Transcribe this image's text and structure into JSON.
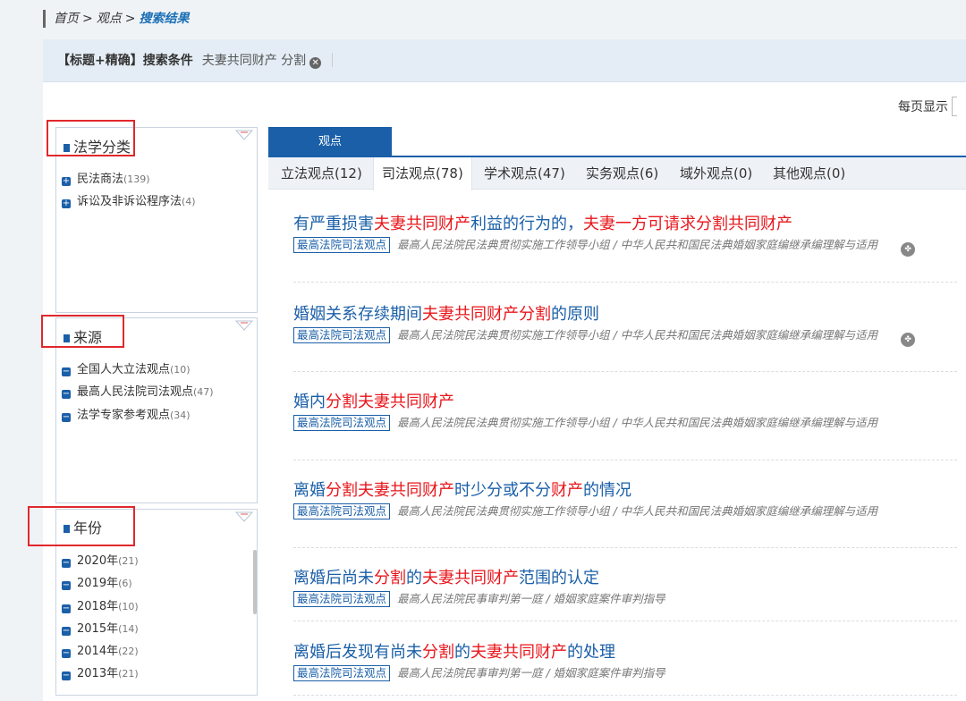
{
  "breadcrumb": {
    "home": "首页",
    "sep1": ">",
    "opinion": "观点",
    "sep2": ">",
    "current": "搜索结果"
  },
  "search": {
    "label": "【标题+精确】搜索条件",
    "terms": "夫妻共同财产 分割",
    "clear_icon": "✕"
  },
  "per_page_label": "每页显示",
  "filters": {
    "category": {
      "title": "法学分类",
      "items": [
        {
          "label": "民法商法",
          "count": "(139)"
        },
        {
          "label": "诉讼及非诉讼程序法",
          "count": "(4)"
        }
      ]
    },
    "source": {
      "title": "来源",
      "items": [
        {
          "label": "全国人大立法观点",
          "count": "(10)"
        },
        {
          "label": "最高人民法院司法观点",
          "count": "(47)"
        },
        {
          "label": "法学专家参考观点",
          "count": "(34)"
        }
      ]
    },
    "year": {
      "title": "年份",
      "items": [
        {
          "label": "2020年",
          "count": "(21)"
        },
        {
          "label": "2019年",
          "count": "(6)"
        },
        {
          "label": "2018年",
          "count": "(10)"
        },
        {
          "label": "2015年",
          "count": "(14)"
        },
        {
          "label": "2014年",
          "count": "(22)"
        },
        {
          "label": "2013年",
          "count": "(21)"
        }
      ]
    }
  },
  "main_tab": "观点",
  "subtabs": [
    "立法观点(12)",
    "司法观点(78)",
    "学术观点(47)",
    "实务观点(6)",
    "域外观点(0)",
    "其他观点(0)"
  ],
  "results": [
    {
      "title_parts": [
        "有严重损害",
        "夫妻共同财产",
        "利益的行为的，",
        "夫妻一方可请求",
        "分割共同财产"
      ],
      "tag": "最高法院司法观点",
      "source": "最高人民法院民法典贯彻实施工作领导小组 / 中华人民共和国民法典婚姻家庭编继承编理解与适用"
    },
    {
      "title_parts": [
        "婚姻关系存续期间",
        "夫妻共同财产分割",
        "的原则"
      ],
      "tag": "最高法院司法观点",
      "source": "最高人民法院民法典贯彻实施工作领导小组 / 中华人民共和国民法典婚姻家庭编继承编理解与适用"
    },
    {
      "title_parts": [
        "婚内",
        "分割夫妻共同财产",
        ""
      ],
      "tag": "最高法院司法观点",
      "source": "最高人民法院民法典贯彻实施工作领导小组 / 中华人民共和国民法典婚姻家庭编继承编理解与适用"
    },
    {
      "title_parts": [
        "离婚",
        "分割夫妻共同财产",
        "时少分或不分",
        "财产",
        "的情况"
      ],
      "tag": "最高法院司法观点",
      "source": "最高人民法院民法典贯彻实施工作领导小组 / 中华人民共和国民法典婚姻家庭编继承编理解与适用"
    },
    {
      "title_parts": [
        "离婚后尚未",
        "分割",
        "的",
        "夫妻共同财产",
        "范围的认定"
      ],
      "tag": "最高法院司法观点",
      "source": "最高人民法院民事审判第一庭 / 婚姻家庭案件审判指导"
    },
    {
      "title_parts": [
        "离婚后发现有尚未",
        "分割",
        "的",
        "夫妻共同财产",
        "的处理"
      ],
      "tag": "最高法院司法观点",
      "source": "最高人民法院民事审判第一庭 / 婚姻家庭案件审判指导"
    }
  ],
  "colors": {
    "accent": "#1a5fa8",
    "highlight": "#e8161b",
    "annotation": "#e0282c"
  },
  "icons": {
    "share": "share-icon",
    "clear": "clear-icon",
    "collapse": "collapse-corner-icon"
  }
}
